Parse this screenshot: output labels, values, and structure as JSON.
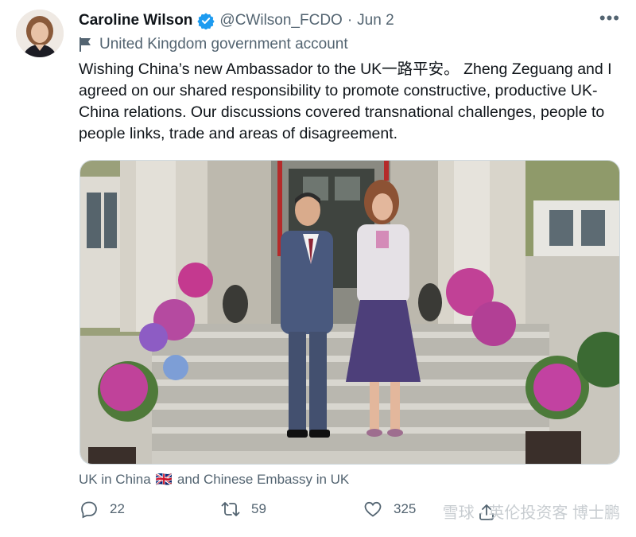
{
  "tweet": {
    "display_name": "Caroline Wilson",
    "handle": "@CWilson_FCDO",
    "separator": "·",
    "date": "Jun 2",
    "more_label": "•••",
    "account_label": "United Kingdom government account",
    "text": "Wishing China’s new Ambassador to the UK一路平安。 Zheng Zeguang and I agreed on our shared responsibility to promote constructive, productive UK-China relations. Our discussions covered transnational challenges, people to people links, trade and areas of disagreement.",
    "caption_part1": "UK in China",
    "caption_flag": "🇬🇧",
    "caption_part2": "and Chinese Embassy in UK"
  },
  "actions": {
    "replies": "22",
    "retweets": "59",
    "likes": "325"
  },
  "watermark": "雪球 · 英伦投资客 博士鹏",
  "colors": {
    "verified": "#1d9bf0",
    "muted_text": "#536471",
    "primary_text": "#0f1419"
  }
}
